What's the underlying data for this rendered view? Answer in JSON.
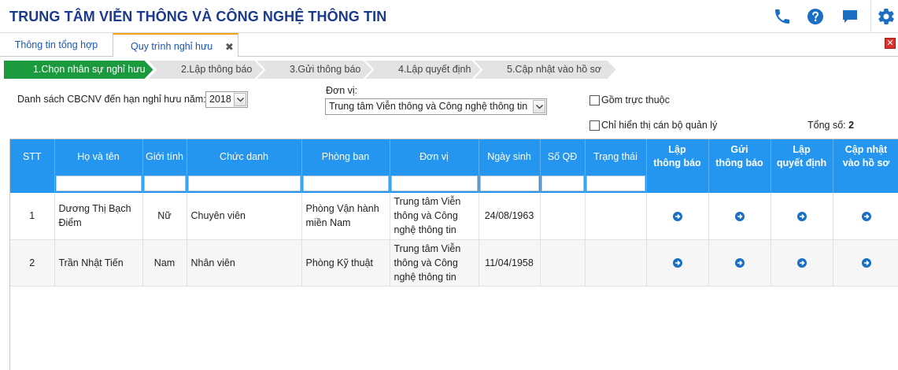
{
  "header": {
    "title": "TRUNG TÂM VIỄN THÔNG VÀ CÔNG NGHỆ THÔNG TIN",
    "icons": [
      "phone-icon",
      "help-icon",
      "chat-icon",
      "gear-icon"
    ],
    "accent_color": "#1b3a8c"
  },
  "tabs": [
    {
      "label": "Thông tin tổng hợp",
      "active": false
    },
    {
      "label": "Quy trình nghỉ hưu",
      "active": true
    }
  ],
  "tab_close_glyph": "✖",
  "window_close_glyph": "✕",
  "steps": [
    {
      "label": "1.Chọn nhân sự nghỉ hưu",
      "active": true
    },
    {
      "label": "2.Lập thông báo",
      "active": false
    },
    {
      "label": "3.Gửi thông báo",
      "active": false
    },
    {
      "label": "4.Lập quyết định",
      "active": false
    },
    {
      "label": "5.Cập nhật vào hồ sơ",
      "active": false
    }
  ],
  "filters": {
    "year_label": "Danh sách CBCNV đến hạn nghỉ hưu năm:",
    "year_value": "2018",
    "unit_label": "Đơn vị:",
    "unit_value": "Trung tâm Viễn thông và Công nghệ thông tin",
    "include_sub_label": "Gồm trực thuộc",
    "include_sub_checked": false,
    "managers_only_label": "Chỉ hiển thị cán bộ quản lý",
    "managers_only_checked": false,
    "total_label": "Tổng số:",
    "total_value": "2"
  },
  "table": {
    "columns": {
      "stt": "STT",
      "name": "Họ và tên",
      "gender": "Giới tính",
      "title": "Chức danh",
      "dept": "Phòng ban",
      "unit": "Đơn vị",
      "dob": "Ngày sinh",
      "decision_no": "Số QĐ",
      "status": "Trạng thái",
      "notice_1": "Lập",
      "notice_2": "thông báo",
      "send_1": "Gửi",
      "send_2": "thông báo",
      "decide_1": "Lập",
      "decide_2": "quyết định",
      "update_1": "Cập nhật",
      "update_2": "vào hồ sơ"
    },
    "rows": [
      {
        "stt": "1",
        "name_1": "Dương Thị Bạch",
        "name_2": "Điểm",
        "gender": "Nữ",
        "title": "Chuyên viên",
        "dept_1": "Phòng Vận hành",
        "dept_2": "miền Nam",
        "unit_1": "Trung tâm Viễn",
        "unit_2": "thông và Công",
        "unit_3": "nghệ thông tin",
        "dob": "24/08/1963",
        "decision_no": "",
        "status": ""
      },
      {
        "stt": "2",
        "name_1": "Trần Nhật Tiến",
        "name_2": "",
        "gender": "Nam",
        "title": "Nhân viên",
        "dept_1": "Phòng Kỹ thuật",
        "dept_2": "",
        "unit_1": "Trung tâm Viễn",
        "unit_2": "thông và Công",
        "unit_3": "nghệ thông tin",
        "dob": "11/04/1958",
        "decision_no": "",
        "status": ""
      }
    ]
  },
  "colors": {
    "step_active": "#1a9a3c",
    "step_inactive": "#e3e3e3",
    "grid_header": "#2596ef",
    "action_icon": "#1a6fc4",
    "tab_active_top": "#f1a20c"
  }
}
